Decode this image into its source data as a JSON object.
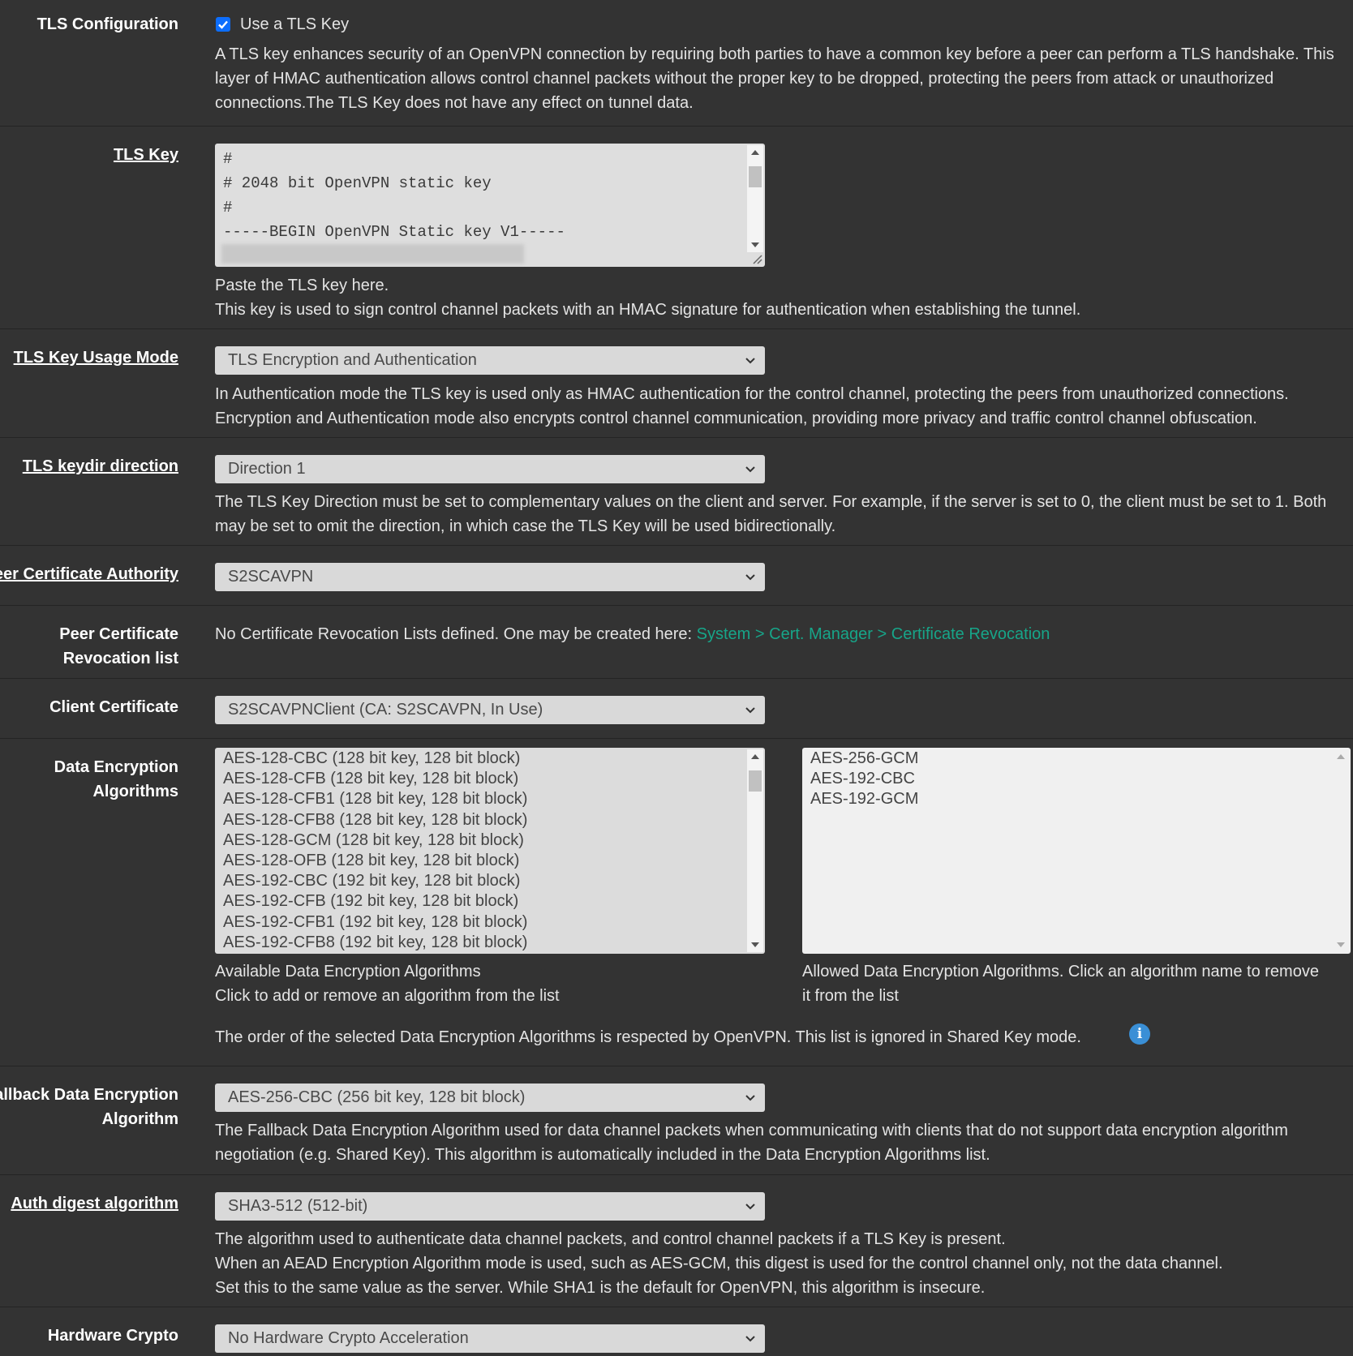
{
  "tls_config": {
    "label": "TLS Configuration",
    "checkbox_label": "Use a TLS Key",
    "checked": true,
    "help": "A TLS key enhances security of an OpenVPN connection by requiring both parties to have a common key before a peer can perform a TLS handshake. This layer of HMAC authentication allows control channel packets without the proper key to be dropped, protecting the peers from attack or unauthorized connections.The TLS Key does not have any effect on tunnel data."
  },
  "tls_key": {
    "label": "TLS Key",
    "lines": [
      "#",
      "# 2048 bit OpenVPN static key",
      "#",
      "-----BEGIN OpenVPN Static key V1-----"
    ],
    "help1": "Paste the TLS key here.",
    "help2": "This key is used to sign control channel packets with an HMAC signature for authentication when establishing the tunnel."
  },
  "tls_key_usage": {
    "label": "TLS Key Usage Mode",
    "value": "TLS Encryption and Authentication",
    "help": "In Authentication mode the TLS key is used only as HMAC authentication for the control channel, protecting the peers from unauthorized connections. Encryption and Authentication mode also encrypts control channel communication, providing more privacy and traffic control channel obfuscation."
  },
  "tls_keydir": {
    "label": "TLS keydir direction",
    "value": "Direction 1",
    "help": "The TLS Key Direction must be set to complementary values on the client and server. For example, if the server is set to 0, the client must be set to 1. Both may be set to omit the direction, in which case the TLS Key will be used bidirectionally."
  },
  "peer_ca": {
    "label": "eer Certificate Authority",
    "value": "S2SCAVPN"
  },
  "peer_crl": {
    "label_line1": "Peer Certificate",
    "label_line2": "Revocation list",
    "text": "No Certificate Revocation Lists defined. One may be created here: ",
    "link": "System > Cert. Manager > Certificate Revocation"
  },
  "client_cert": {
    "label": "Client Certificate",
    "value": "S2SCAVPNClient (CA: S2SCAVPN, In Use)"
  },
  "data_enc": {
    "label_line1": "Data Encryption",
    "label_line2": "Algorithms",
    "available": [
      "AES-128-CBC (128 bit key, 128 bit block)",
      "AES-128-CFB (128 bit key, 128 bit block)",
      "AES-128-CFB1 (128 bit key, 128 bit block)",
      "AES-128-CFB8 (128 bit key, 128 bit block)",
      "AES-128-GCM (128 bit key, 128 bit block)",
      "AES-128-OFB (128 bit key, 128 bit block)",
      "AES-192-CBC (192 bit key, 128 bit block)",
      "AES-192-CFB (192 bit key, 128 bit block)",
      "AES-192-CFB1 (192 bit key, 128 bit block)",
      "AES-192-CFB8 (192 bit key, 128 bit block)"
    ],
    "allowed": [
      "AES-256-GCM",
      "AES-192-CBC",
      "AES-192-GCM"
    ],
    "available_help1": "Available Data Encryption Algorithms",
    "available_help2": "Click to add or remove an algorithm from the list",
    "allowed_help1": "Allowed Data Encryption Algorithms. Click an algorithm name to remove",
    "allowed_help2": "it from the list",
    "order_note": "The order of the selected Data Encryption Algorithms is respected by OpenVPN. This list is ignored in Shared Key mode.",
    "info_glyph": "i"
  },
  "fallback": {
    "label_line1": "allback Data Encryption",
    "label_line2": "Algorithm",
    "value": "AES-256-CBC (256 bit key, 128 bit block)",
    "help": "The Fallback Data Encryption Algorithm used for data channel packets when communicating with clients that do not support data encryption algorithm negotiation (e.g. Shared Key). This algorithm is automatically included in the Data Encryption Algorithms list."
  },
  "auth_digest": {
    "label": "Auth digest algorithm",
    "value": "SHA3-512 (512-bit)",
    "help1": "The algorithm used to authenticate data channel packets, and control channel packets if a TLS Key is present.",
    "help2": "When an AEAD Encryption Algorithm mode is used, such as AES-GCM, this digest is used for the control channel only, not the data channel.",
    "help3": "Set this to the same value as the server. While SHA1 is the default for OpenVPN, this algorithm is insecure."
  },
  "hw_crypto": {
    "label": "Hardware Crypto",
    "value": "No Hardware Crypto Acceleration"
  },
  "colors": {
    "background": "#333333",
    "link": "#17a589",
    "checkbox": "#0d6efd",
    "info": "#3a8fd6"
  }
}
